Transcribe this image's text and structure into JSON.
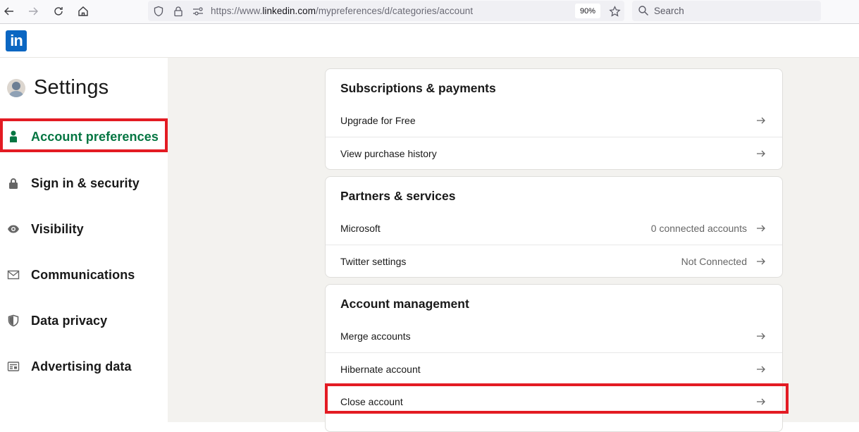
{
  "browser": {
    "url_scheme": "https://www.",
    "url_host": "linkedin.com",
    "url_path": "/mypreferences/d/categories/account",
    "zoom_level": "90%",
    "search_placeholder": "Search"
  },
  "header": {
    "logo_text": "in"
  },
  "sidebar": {
    "title": "Settings",
    "items": [
      {
        "label": "Account preferences",
        "icon": "person-icon",
        "active": true
      },
      {
        "label": "Sign in & security",
        "icon": "lock-icon",
        "active": false
      },
      {
        "label": "Visibility",
        "icon": "eye-icon",
        "active": false
      },
      {
        "label": "Communications",
        "icon": "envelope-icon",
        "active": false
      },
      {
        "label": "Data privacy",
        "icon": "shield-icon",
        "active": false
      },
      {
        "label": "Advertising data",
        "icon": "newspaper-icon",
        "active": false
      }
    ]
  },
  "main": {
    "sections": [
      {
        "title": "Subscriptions & payments",
        "rows": [
          {
            "label": "Upgrade for Free",
            "value": ""
          },
          {
            "label": "View purchase history",
            "value": ""
          }
        ]
      },
      {
        "title": "Partners & services",
        "rows": [
          {
            "label": "Microsoft",
            "value": "0 connected accounts"
          },
          {
            "label": "Twitter settings",
            "value": "Not Connected"
          }
        ]
      },
      {
        "title": "Account management",
        "rows": [
          {
            "label": "Merge accounts",
            "value": ""
          },
          {
            "label": "Hibernate account",
            "value": ""
          },
          {
            "label": "Close account",
            "value": ""
          }
        ]
      }
    ]
  },
  "colors": {
    "linkedin_blue": "#0a66c2",
    "active_green": "#057642",
    "highlight_red": "#e31b23",
    "page_background": "#f3f2ef"
  }
}
